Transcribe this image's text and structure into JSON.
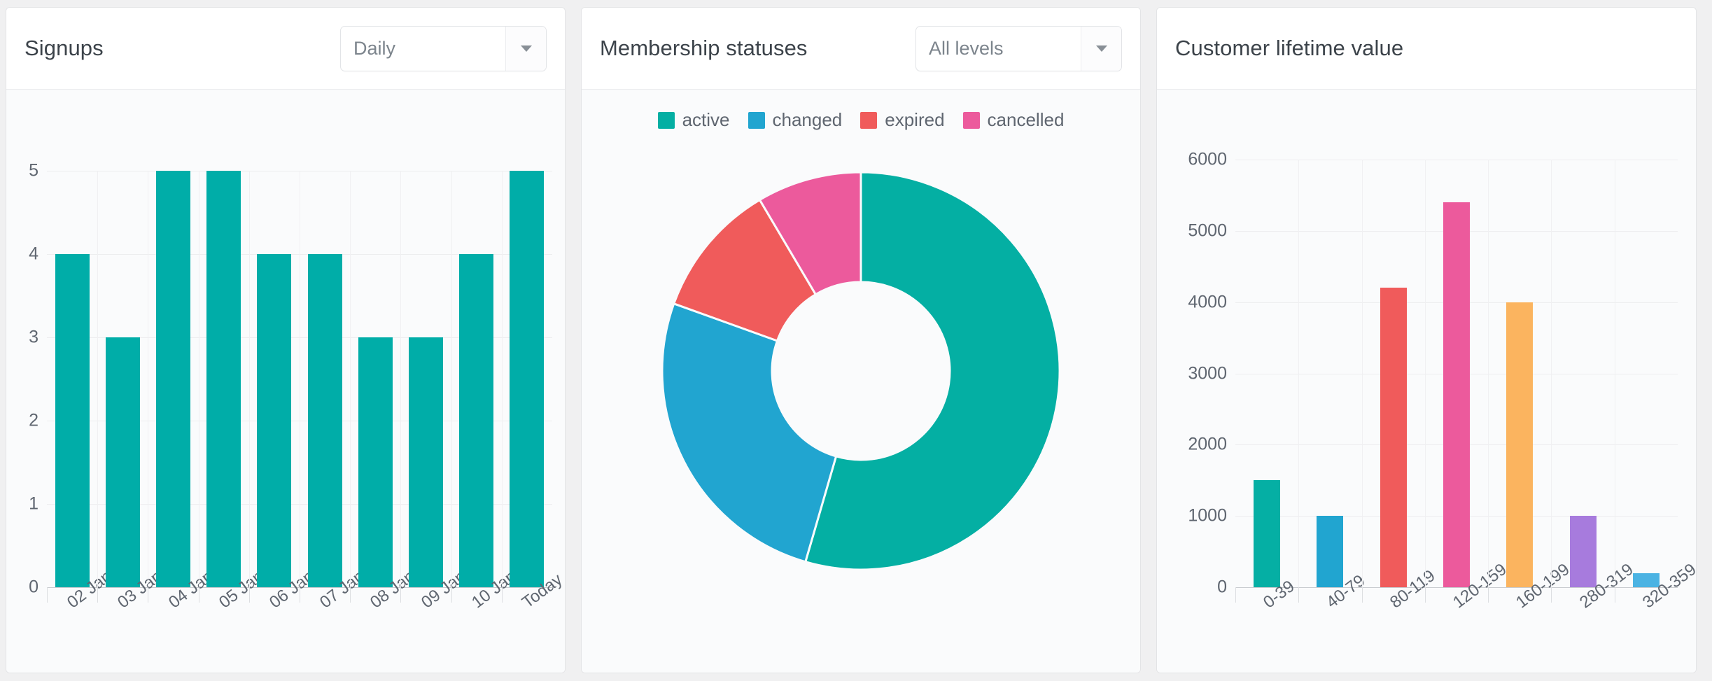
{
  "panels": {
    "signups": {
      "title": "Signups",
      "select": {
        "value": "Daily",
        "icon": "chevron-down-icon"
      }
    },
    "statuses": {
      "title": "Membership statuses",
      "select": {
        "value": "All levels",
        "icon": "chevron-down-icon"
      }
    },
    "clv": {
      "title": "Customer lifetime value"
    }
  },
  "chart_data": [
    {
      "type": "bar",
      "title": "Signups",
      "xlabel": "",
      "ylabel": "",
      "categories": [
        "02 Jan",
        "03 Jan",
        "04 Jan",
        "05 Jan",
        "06 Jan",
        "07 Jan",
        "08 Jan",
        "09 Jan",
        "10 Jan",
        "Today"
      ],
      "values": [
        4,
        3,
        5,
        5,
        4,
        4,
        3,
        3,
        4,
        5
      ],
      "yticks": [
        0,
        1,
        2,
        3,
        4,
        5
      ],
      "ylim": [
        0,
        5
      ],
      "grid": true,
      "colors": [
        "#00ADA8"
      ],
      "legend": false
    },
    {
      "type": "pie",
      "title": "Membership statuses",
      "donut": true,
      "labels": [
        "active",
        "changed",
        "expired",
        "cancelled"
      ],
      "values": [
        54.5,
        26.0,
        11.0,
        8.5
      ],
      "colors": [
        "#04AFA3",
        "#21A5D0",
        "#F05B5B",
        "#EC5A9C"
      ],
      "legend": true,
      "legend_position": "top"
    },
    {
      "type": "bar",
      "title": "Customer lifetime value",
      "xlabel": "",
      "ylabel": "",
      "categories": [
        "0-39",
        "40-79",
        "80-119",
        "120-159",
        "160-199",
        "280-319",
        "320-359"
      ],
      "values": [
        1500,
        1000,
        4200,
        5400,
        4000,
        1000,
        200
      ],
      "yticks": [
        0,
        1000,
        2000,
        3000,
        4000,
        5000,
        6000
      ],
      "ylim": [
        0,
        6000
      ],
      "grid": true,
      "colors": [
        "#05AFA4",
        "#21A5D0",
        "#F05B5B",
        "#EC5A9C",
        "#FBB45F",
        "#A77BDD",
        "#4BB3E3"
      ],
      "legend": false
    }
  ]
}
